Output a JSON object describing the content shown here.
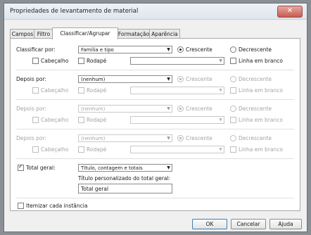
{
  "window": {
    "title": "Propriedades de levantamento de material",
    "close_glyph": "✕"
  },
  "tabs": [
    {
      "label": "Campos"
    },
    {
      "label": "Filtro"
    },
    {
      "label": "Classificar/Agrupar"
    },
    {
      "label": "Formatação"
    },
    {
      "label": "Aparência"
    }
  ],
  "sort_groups": [
    {
      "label": "Classificar por:",
      "value": "Família e tipo",
      "asc": "Crescente",
      "desc": "Decrescente",
      "header": "Cabeçalho",
      "footer": "Rodapé",
      "blank": "Linha em branco"
    },
    {
      "label": "Depois por:",
      "value": "(nenhum)",
      "asc": "Crescente",
      "desc": "Decrescente",
      "header": "Cabeçalho",
      "footer": "Rodapé",
      "blank": "Linha em branco"
    },
    {
      "label": "Depois por:",
      "value": "(nenhum)",
      "asc": "Crescente",
      "desc": "Decrescente",
      "header": "Cabeçalho",
      "footer": "Rodapé",
      "blank": "Linha em branco"
    },
    {
      "label": "Depois por:",
      "value": "(nenhum)",
      "asc": "Crescente",
      "desc": "Decrescente",
      "header": "Cabeçalho",
      "footer": "Rodapé",
      "blank": "Linha em branco"
    }
  ],
  "grand_total": {
    "label": "Total geral:",
    "checked": true,
    "value": "Título, contagem e totais",
    "custom_title_label": "Título personalizado do total geral:",
    "custom_title_value": "Total geral"
  },
  "itemize": {
    "label": "Itemizar cada instância",
    "checked": false
  },
  "buttons": {
    "ok": "OK",
    "cancel": "Cancelar",
    "help": "Ajuda"
  }
}
